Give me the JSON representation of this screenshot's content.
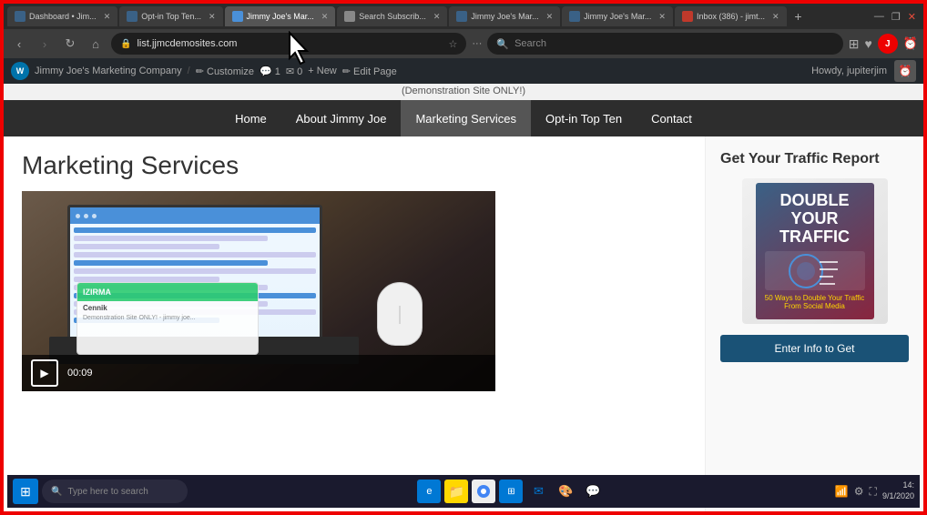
{
  "browser": {
    "tabs": [
      {
        "label": "Dashboard • Jim...",
        "active": false,
        "icon": "wp-icon"
      },
      {
        "label": "Opt-in Top Ten...",
        "active": false,
        "icon": "wp-icon"
      },
      {
        "label": "Jimmy Joe's Mar...",
        "active": true,
        "icon": "wp-icon"
      },
      {
        "label": "Search Subscrib...",
        "active": false,
        "icon": "search-icon"
      },
      {
        "label": "Jimmy Joe's Mar...",
        "active": false,
        "icon": "wp-icon"
      },
      {
        "label": "Jimmy Joe's Mar...",
        "active": false,
        "icon": "wp-icon"
      },
      {
        "label": "Inbox (386) - jimt...",
        "active": false,
        "icon": "mail-icon"
      }
    ],
    "address": "list.jjmcdemosites.com",
    "search_placeholder": "Search",
    "new_tab_label": "+"
  },
  "wp_admin_bar": {
    "logo": "W",
    "site_name": "Jimmy Joe's Marketing Company",
    "customize": "Customize",
    "comments_count": "1",
    "messages_count": "0",
    "new_label": "+ New",
    "edit_page": "Edit Page",
    "howdy": "Howdy, jupiterjim"
  },
  "demo_notice": "(Demonstration Site ONLY!)",
  "site_nav": {
    "items": [
      {
        "label": "Home",
        "active": false
      },
      {
        "label": "About Jimmy Joe",
        "active": false
      },
      {
        "label": "Marketing Services",
        "active": true
      },
      {
        "label": "Opt-in Top Ten",
        "active": false
      },
      {
        "label": "Contact",
        "active": false
      }
    ]
  },
  "main_content": {
    "page_title": "Marketing Services",
    "image_alt": "Marketing laptop and mouse"
  },
  "video_player": {
    "play_label": "▶",
    "time": "00:09"
  },
  "tablet_overlay": {
    "logo": "IZIRMA",
    "title": "Cennik",
    "subtitle": "Demonstration Site ONLY! - jimmy joe..."
  },
  "sidebar": {
    "widget_title": "Get Your Traffic Report",
    "book_title": "DOUBLE YOUR TRAFFIC",
    "book_subtitle": "50 Ways to Double Your Traffic From Social Media",
    "cta_button": "Enter Info to Get"
  },
  "taskbar": {
    "start_icon": "⊞",
    "search_placeholder": "Type here to search",
    "date": "9/1/2020",
    "time": "14:"
  }
}
